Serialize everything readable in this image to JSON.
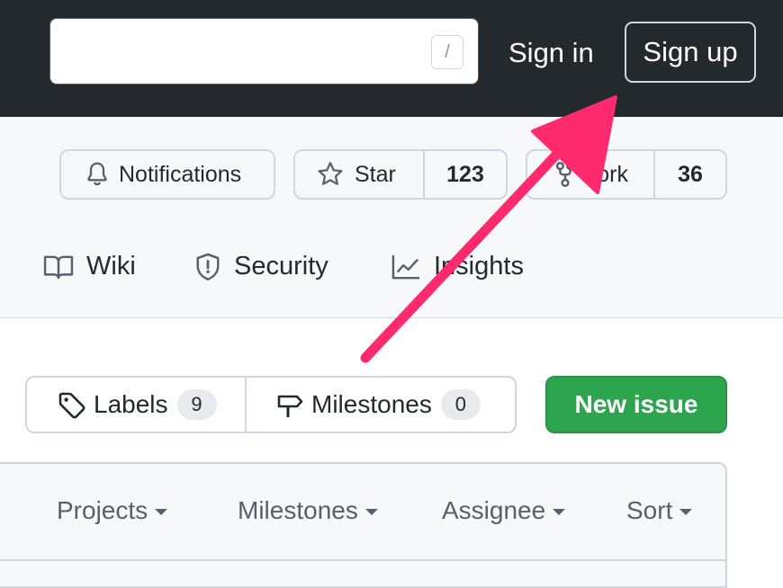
{
  "header": {
    "search_key_hint": "/",
    "sign_in_label": "Sign in",
    "sign_up_label": "Sign up"
  },
  "repo_actions": {
    "notifications_label": "Notifications",
    "star_label": "Star",
    "star_count": "123",
    "fork_label": "Fork",
    "fork_count": "36"
  },
  "repo_tabs": [
    {
      "label": "Wiki",
      "icon": "book-icon"
    },
    {
      "label": "Security",
      "icon": "shield-icon"
    },
    {
      "label": "Insights",
      "icon": "graph-icon"
    }
  ],
  "issues_toolbar": {
    "labels_label": "Labels",
    "labels_count": "9",
    "milestones_label": "Milestones",
    "milestones_count": "0",
    "new_issue_label": "New issue"
  },
  "filters": [
    "Projects",
    "Milestones",
    "Assignee",
    "Sort"
  ],
  "annotation": {
    "arrow_color": "#ff2a6d",
    "target": "sign-up-button"
  },
  "colors": {
    "header_bg": "#24292e",
    "accent_green": "#2da44e",
    "subtle_bg": "#f6f8fa"
  }
}
